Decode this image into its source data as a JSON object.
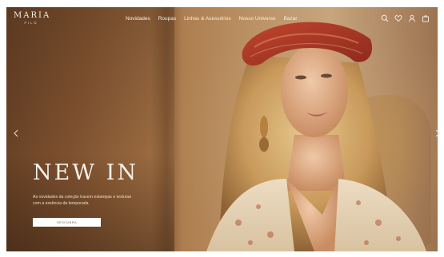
{
  "brand": {
    "name": "MARIA",
    "sub": "FILÓ"
  },
  "nav": {
    "items": [
      {
        "label": "Novidades"
      },
      {
        "label": "Roupas"
      },
      {
        "label": "Linhas & Acessórios"
      },
      {
        "label": "Nosso Universo"
      },
      {
        "label": "Bazar"
      }
    ]
  },
  "hero": {
    "headline": "NEW IN",
    "description": "As novidades da coleção trazem estampas e texturas com a essência da temporada",
    "cta_label": "DESCUBRA"
  },
  "icons": [
    "search-icon",
    "heart-icon",
    "user-icon",
    "bag-icon",
    "chevron-left-icon",
    "chevron-right-icon"
  ],
  "colors": {
    "text_light": "#f6efe6",
    "button_bg": "#ffffff"
  }
}
